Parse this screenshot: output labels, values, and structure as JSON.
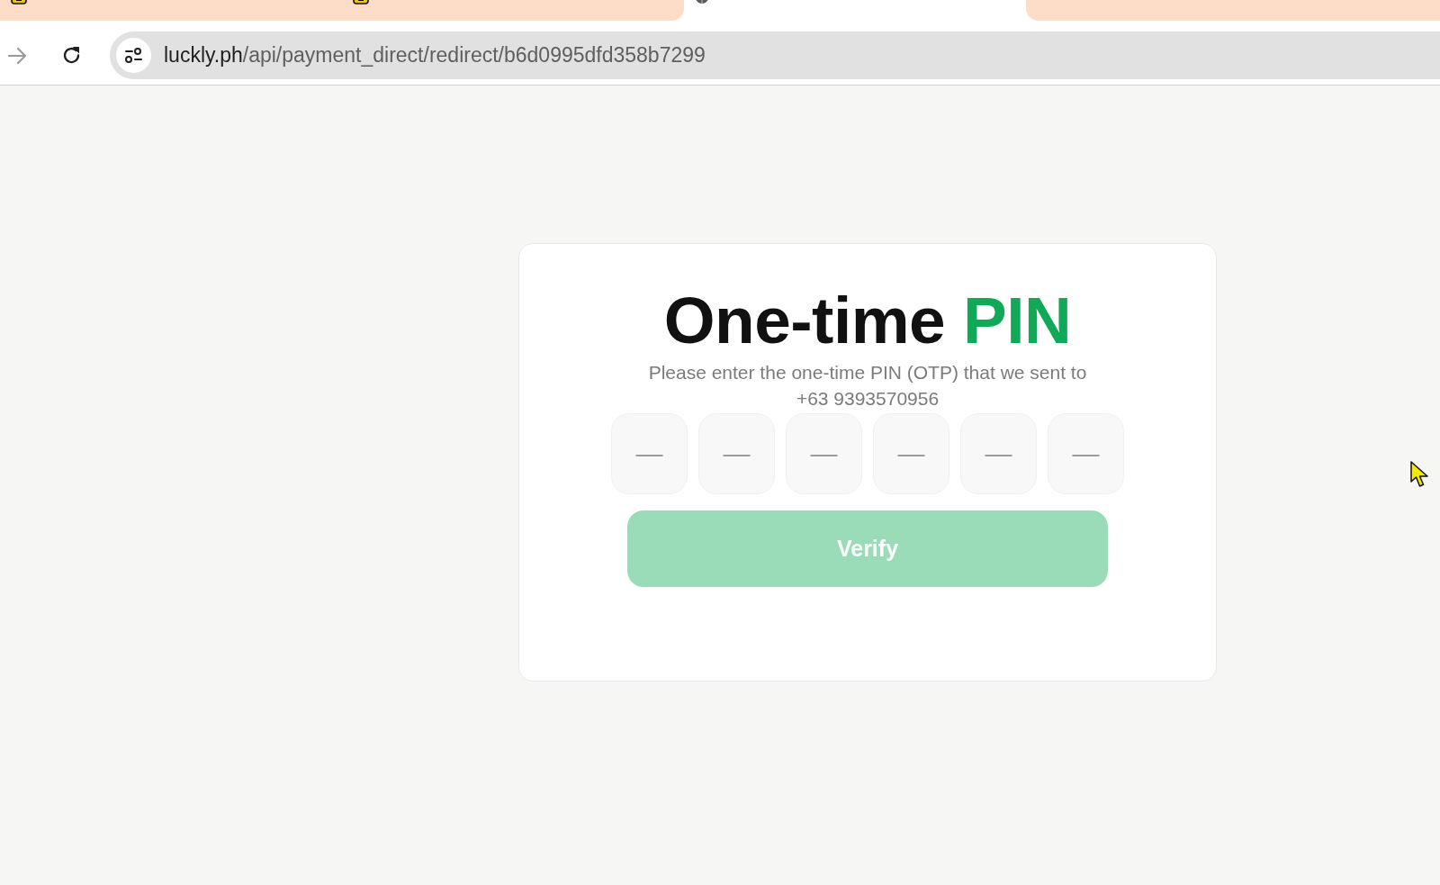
{
  "browser": {
    "tabs": [
      {
        "kind": "favicon",
        "selected": false
      },
      {
        "kind": "favicon",
        "selected": false
      },
      {
        "kind": "globe",
        "selected": true
      },
      {
        "kind": "blank",
        "selected": false
      }
    ],
    "forward_button": {
      "disabled": true
    },
    "address_bar": {
      "domain": "luckly.ph",
      "path": "/api/payment_direct/redirect/b6d0995dfd358b7299"
    }
  },
  "otp_card": {
    "title": {
      "text": "One-time",
      "accent": "PIN"
    },
    "message": "Please enter the one-time PIN (OTP) that we sent to",
    "phone": "+63 9393570956",
    "pin_fields": [
      {
        "placeholder": "—"
      },
      {
        "placeholder": "—"
      },
      {
        "placeholder": "—"
      },
      {
        "placeholder": "—"
      },
      {
        "placeholder": "—"
      },
      {
        "placeholder": "—"
      }
    ],
    "verify_button": {
      "label": "Verify",
      "disabled": true
    }
  }
}
